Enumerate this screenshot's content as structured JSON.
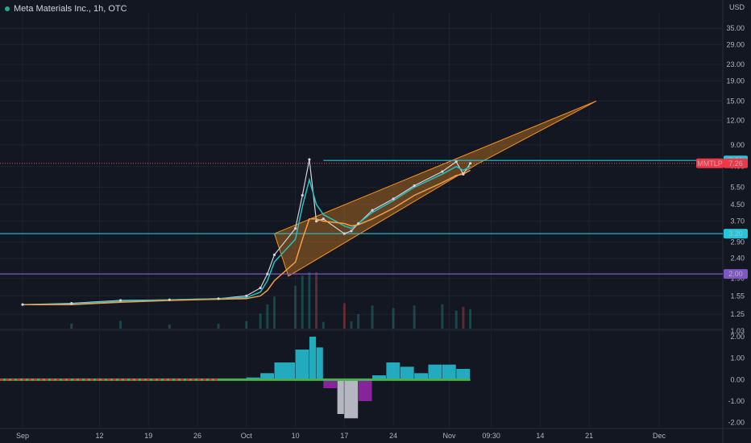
{
  "header": {
    "title": "Meta Materials Inc., 1h, OTC",
    "currency": "USD",
    "accent_color": "#22ab94"
  },
  "price_axis": {
    "ticks": [
      "35.00",
      "29.00",
      "23.00",
      "19.00",
      "15.00",
      "12.00",
      "9.00",
      "7.00",
      "5.50",
      "4.50",
      "3.70",
      "2.90",
      "2.40",
      "1.90",
      "1.55",
      "1.25",
      "1.03"
    ]
  },
  "osc_axis": {
    "ticks": [
      "2.00",
      "1.00",
      "0.00",
      "-1.00",
      "-2.00"
    ]
  },
  "time_axis": {
    "ticks": [
      "Sep",
      "12",
      "19",
      "26",
      "Oct",
      "10",
      "17",
      "24",
      "Nov",
      "09:30",
      "14",
      "21",
      "Dec"
    ]
  },
  "badges": {
    "price_top": "7.51",
    "symbol": "MMTLP",
    "last_price": "7.26",
    "level_320": "3.20",
    "level_200": "2.00"
  },
  "chart_data": [
    {
      "type": "line",
      "scale": "log",
      "ylim": [
        1.0,
        40.0
      ],
      "x": [
        "2022-09-01",
        "2022-09-08",
        "2022-09-15",
        "2022-09-22",
        "2022-09-29",
        "2022-10-03",
        "2022-10-05",
        "2022-10-06",
        "2022-10-07",
        "2022-10-10",
        "2022-10-11",
        "2022-10-12",
        "2022-10-13",
        "2022-10-14",
        "2022-10-17",
        "2022-10-18",
        "2022-10-19",
        "2022-10-21",
        "2022-10-24",
        "2022-10-27",
        "2022-10-31",
        "2022-11-02",
        "2022-11-03",
        "2022-11-04"
      ],
      "series": [
        {
          "color": "#d1d4dc",
          "values": [
            1.4,
            1.42,
            1.47,
            1.48,
            1.5,
            1.55,
            1.7,
            2.0,
            2.5,
            3.4,
            5.0,
            7.6,
            3.7,
            3.8,
            3.2,
            3.3,
            3.6,
            4.2,
            4.8,
            5.6,
            6.6,
            7.4,
            6.4,
            7.26
          ]
        },
        {
          "color": "#22c2c6",
          "values": [
            1.4,
            1.41,
            1.46,
            1.48,
            1.5,
            1.52,
            1.62,
            1.85,
            2.3,
            3.0,
            4.4,
            6.0,
            4.5,
            4.0,
            3.5,
            3.4,
            3.6,
            4.1,
            4.7,
            5.5,
            6.4,
            7.0,
            6.7,
            7.0
          ]
        },
        {
          "color": "#f39c4a",
          "values": [
            1.4,
            1.4,
            1.44,
            1.47,
            1.49,
            1.5,
            1.55,
            1.65,
            1.85,
            2.3,
            3.0,
            3.8,
            3.8,
            3.7,
            3.6,
            3.5,
            3.55,
            3.8,
            4.3,
            5.0,
            5.8,
            6.3,
            6.4,
            6.7
          ]
        }
      ],
      "levels": [
        {
          "value": 7.51,
          "color": "#26c6da"
        },
        {
          "value": 3.2,
          "color": "#26c6da"
        },
        {
          "value": 2.0,
          "color": "#7e57c2"
        }
      ],
      "channel": {
        "upper": [
          {
            "x": "2022-10-07",
            "y": 3.2
          },
          {
            "x": "2022-11-22",
            "y": 15.0
          }
        ],
        "lower": [
          {
            "x": "2022-10-09",
            "y": 1.95
          },
          {
            "x": "2022-11-05",
            "y": 7.2
          }
        ],
        "color": "#f7931e"
      }
    },
    {
      "type": "bar",
      "ylim": [
        -2.2,
        2.3
      ],
      "x": [
        "2022-09-01",
        "2022-09-08",
        "2022-09-15",
        "2022-09-22",
        "2022-09-29",
        "2022-10-03",
        "2022-10-05",
        "2022-10-07",
        "2022-10-10",
        "2022-10-12",
        "2022-10-13",
        "2022-10-14",
        "2022-10-16",
        "2022-10-17",
        "2022-10-19",
        "2022-10-21",
        "2022-10-23",
        "2022-10-25",
        "2022-10-27",
        "2022-10-29",
        "2022-10-31",
        "2022-11-02",
        "2022-11-04"
      ],
      "values": [
        0.03,
        0.05,
        0.04,
        0.03,
        0.04,
        0.1,
        0.3,
        0.8,
        1.4,
        2.0,
        1.5,
        -0.4,
        -1.6,
        -1.8,
        -1.0,
        0.2,
        0.8,
        0.6,
        0.3,
        0.7,
        0.7,
        0.5,
        0.3
      ],
      "colors": {
        "up": "#26c6da",
        "down_strong": "#d1d4dc",
        "down": "#9c27b0",
        "baseline_up": "#4caf50",
        "baseline_down": "#ff1744"
      }
    }
  ]
}
